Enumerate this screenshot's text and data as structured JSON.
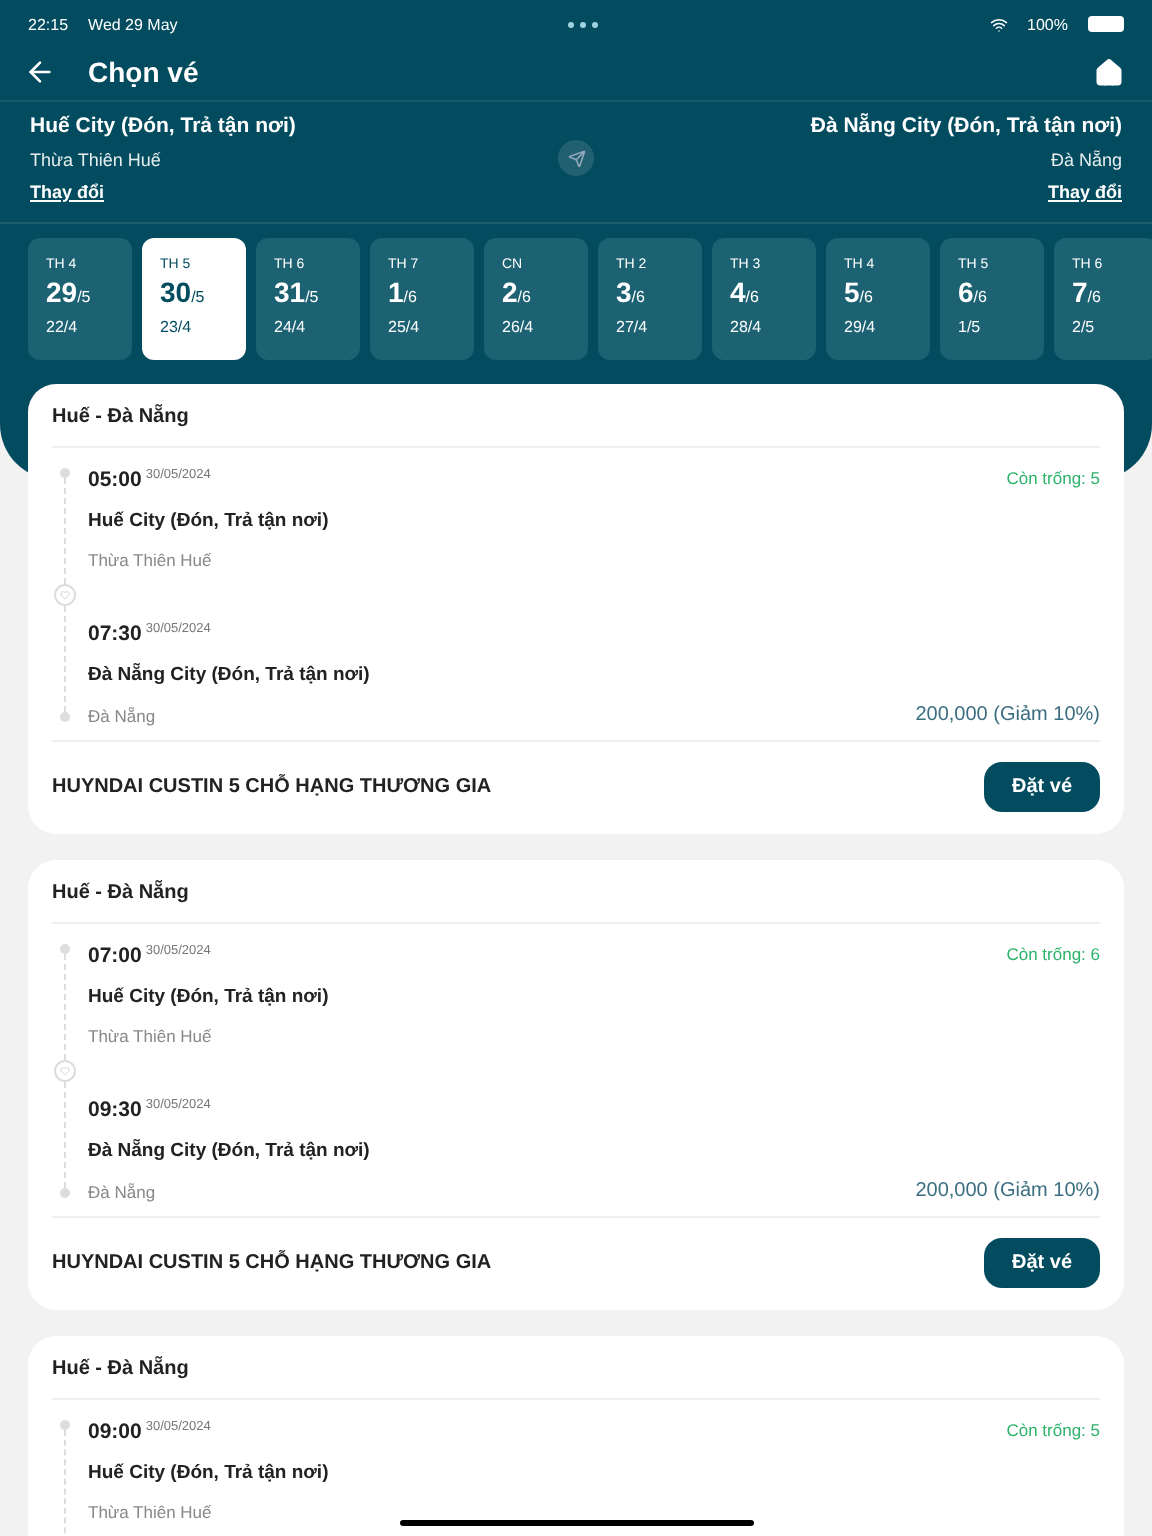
{
  "status_bar": {
    "time": "22:15",
    "date": "Wed 29 May",
    "battery": "100%"
  },
  "header": {
    "title": "Chọn vé"
  },
  "route": {
    "origin": {
      "name": "Huế City (Đón, Trả tận nơi)",
      "region": "Thừa Thiên Huế",
      "change": "Thay đổi"
    },
    "destination": {
      "name": "Đà Nẵng City (Đón, Trả tận nơi)",
      "region": "Đà Nẵng",
      "change": "Thay đổi"
    }
  },
  "dates": [
    {
      "weekday": "TH 4",
      "day": "29",
      "month": "/5",
      "lunar": "22/4",
      "selected": false
    },
    {
      "weekday": "TH 5",
      "day": "30",
      "month": "/5",
      "lunar": "23/4",
      "selected": true
    },
    {
      "weekday": "TH 6",
      "day": "31",
      "month": "/5",
      "lunar": "24/4",
      "selected": false
    },
    {
      "weekday": "TH 7",
      "day": "1",
      "month": "/6",
      "lunar": "25/4",
      "selected": false
    },
    {
      "weekday": "CN",
      "day": "2",
      "month": "/6",
      "lunar": "26/4",
      "selected": false
    },
    {
      "weekday": "TH 2",
      "day": "3",
      "month": "/6",
      "lunar": "27/4",
      "selected": false
    },
    {
      "weekday": "TH 3",
      "day": "4",
      "month": "/6",
      "lunar": "28/4",
      "selected": false
    },
    {
      "weekday": "TH 4",
      "day": "5",
      "month": "/6",
      "lunar": "29/4",
      "selected": false
    },
    {
      "weekday": "TH 5",
      "day": "6",
      "month": "/6",
      "lunar": "1/5",
      "selected": false
    },
    {
      "weekday": "TH 6",
      "day": "7",
      "month": "/6",
      "lunar": "2/5",
      "selected": false
    }
  ],
  "trips": [
    {
      "route": "Huế - Đà Nẵng",
      "departure": {
        "time": "05:00",
        "date": "30/05/2024",
        "name": "Huế City (Đón, Trả tận nơi)",
        "region": "Thừa Thiên Huế"
      },
      "arrival": {
        "time": "07:30",
        "date": "30/05/2024",
        "name": "Đà Nẵng City (Đón, Trả tận nơi)",
        "region": "Đà Nẵng"
      },
      "seats": "Còn trống: 5",
      "price": "200,000 (Giảm 10%)",
      "vehicle": "HUYNDAI CUSTIN 5 CHỖ HẠNG THƯƠNG GIA",
      "button": "Đặt vé"
    },
    {
      "route": "Huế - Đà Nẵng",
      "departure": {
        "time": "07:00",
        "date": "30/05/2024",
        "name": "Huế City (Đón, Trả tận nơi)",
        "region": "Thừa Thiên Huế"
      },
      "arrival": {
        "time": "09:30",
        "date": "30/05/2024",
        "name": "Đà Nẵng City (Đón, Trả tận nơi)",
        "region": "Đà Nẵng"
      },
      "seats": "Còn trống: 6",
      "price": "200,000 (Giảm 10%)",
      "vehicle": "HUYNDAI CUSTIN 5 CHỖ HẠNG THƯƠNG GIA",
      "button": "Đặt vé"
    },
    {
      "route": "Huế - Đà Nẵng",
      "departure": {
        "time": "09:00",
        "date": "30/05/2024",
        "name": "Huế City (Đón, Trả tận nơi)",
        "region": "Thừa Thiên Huế"
      },
      "seats": "Còn trống: 5"
    }
  ]
}
